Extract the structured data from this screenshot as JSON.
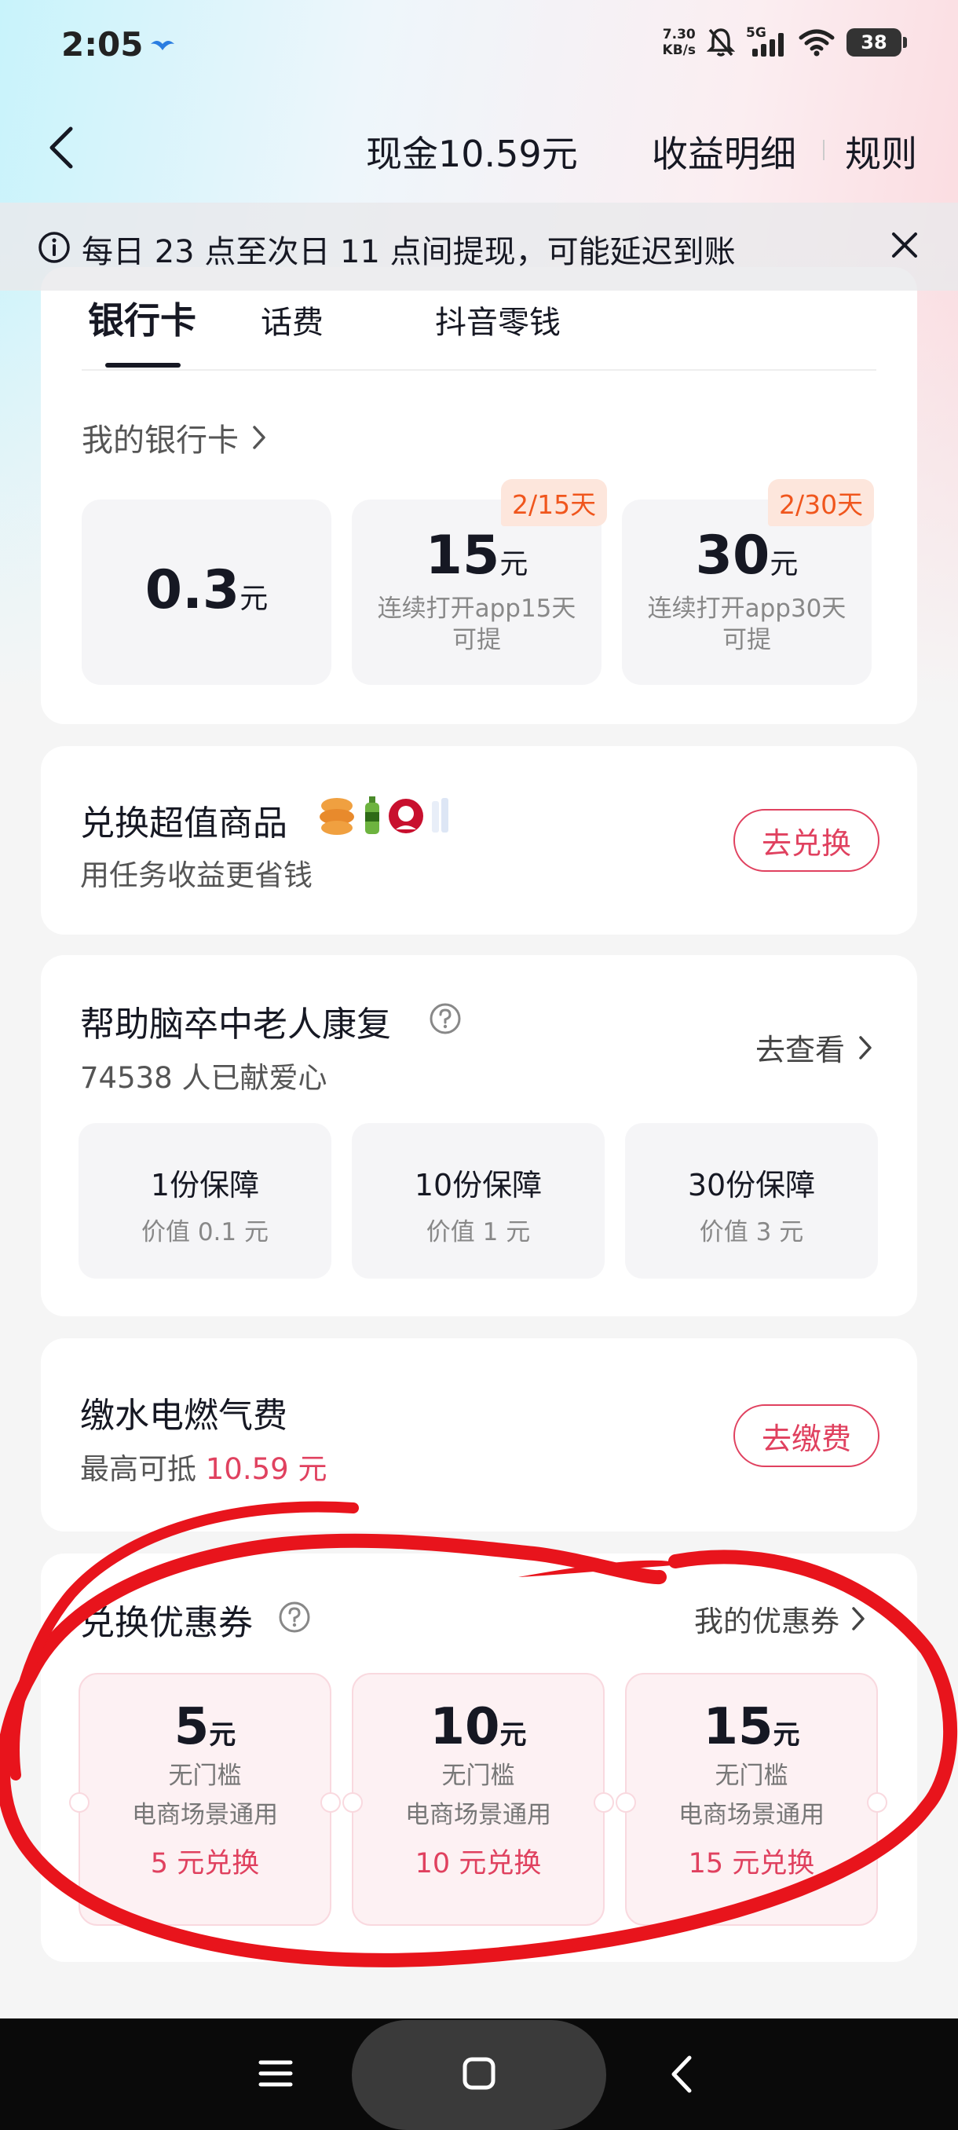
{
  "status_bar": {
    "time": "2:05",
    "speed_value": "7.30",
    "speed_unit": "KB/s",
    "network": "5G",
    "battery": "38"
  },
  "header": {
    "title": "现金10.59元",
    "income_link": "收益明细",
    "rules_link": "规则"
  },
  "notice": {
    "text": "每日 23 点至次日 11 点间提现，可能延迟到账"
  },
  "withdraw": {
    "tabs": [
      {
        "label": "银行卡",
        "active": true
      },
      {
        "label": "话费",
        "active": false
      },
      {
        "label": "抖音零钱",
        "active": false
      }
    ],
    "my_bank_card": "我的银行卡",
    "options": [
      {
        "amount": "0.3",
        "unit": "元",
        "note": "",
        "badge": ""
      },
      {
        "amount": "15",
        "unit": "元",
        "note": "连续打开app15天可提",
        "badge": "2/15天"
      },
      {
        "amount": "30",
        "unit": "元",
        "note": "连续打开app30天可提",
        "badge": "2/30天"
      }
    ]
  },
  "exchange_goods": {
    "title": "兑换超值商品",
    "subtitle": "用任务收益更省钱",
    "button": "去兑换"
  },
  "charity": {
    "title": "帮助脑卒中老人康复",
    "count": "74538",
    "count_suffix": "人已献爱心",
    "link": "去查看",
    "options": [
      {
        "title": "1份保障",
        "value": "价值 0.1 元"
      },
      {
        "title": "10份保障",
        "value": "价值 1 元"
      },
      {
        "title": "30份保障",
        "value": "价值 3 元"
      }
    ]
  },
  "utilities": {
    "title": "缴水电燃气费",
    "subtitle_prefix": "最高可抵",
    "subtitle_amount": "10.59 元",
    "button": "去缴费"
  },
  "coupons": {
    "title": "兑换优惠券",
    "my_coupons": "我的优惠券",
    "items": [
      {
        "amount": "5",
        "unit": "元",
        "line1": "无门槛",
        "line2": "电商场景通用",
        "redeem": "5 元兑换"
      },
      {
        "amount": "10",
        "unit": "元",
        "line1": "无门槛",
        "line2": "电商场景通用",
        "redeem": "10 元兑换"
      },
      {
        "amount": "15",
        "unit": "元",
        "line1": "无门槛",
        "line2": "电商场景通用",
        "redeem": "15 元兑换"
      }
    ]
  },
  "colors": {
    "accent_red": "#e0415f",
    "badge_orange": "#f0561d",
    "annotation_red": "#e8141c"
  }
}
